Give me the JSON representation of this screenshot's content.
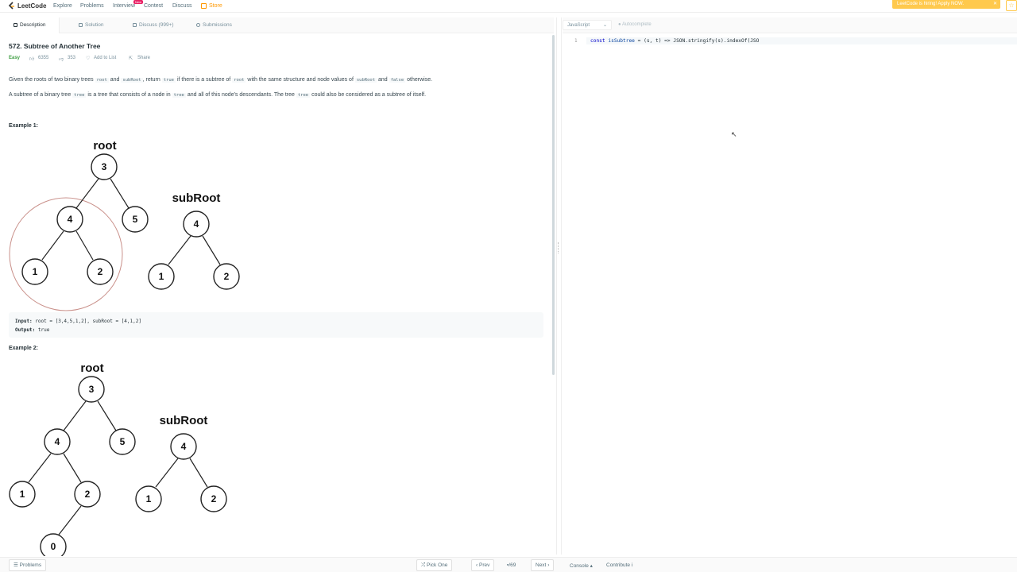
{
  "nav": {
    "logo": "LeetCode",
    "items": [
      "Explore",
      "Problems",
      "Interview",
      "Contest",
      "Discuss",
      "Store"
    ],
    "new_badge": "New",
    "hiring": "LeetCode is hiring! Apply NOW."
  },
  "tabs": [
    "Description",
    "Solution",
    "Discuss (999+)",
    "Submissions"
  ],
  "problem": {
    "title": "572. Subtree of Another Tree",
    "difficulty": "Easy",
    "likes": "6355",
    "dislikes": "353",
    "add_to_list": "Add to List",
    "share": "Share",
    "p1": {
      "a": "Given the roots of two binary trees",
      "c1": "root",
      "b": "and",
      "c2": "subRoot",
      "c": ", return",
      "c3": "true",
      "d": "if there is a subtree of",
      "c4": "root",
      "e": "with the same structure and node values of",
      "c5": "subRoot",
      "f": "and",
      "c6": "false",
      "g": "otherwise."
    },
    "p2": {
      "a": "A subtree of a binary tree",
      "c1": "tree",
      "b": "is a tree that consists of a node in",
      "c2": "tree",
      "c": "and all of this node's descendants. The tree",
      "c3": "tree",
      "d": "could also be considered as a subtree of itself."
    },
    "example1": {
      "heading": "Example 1:",
      "root_label": "root",
      "sub_label": "subRoot",
      "root_nodes": [
        "3",
        "4",
        "5",
        "1",
        "2"
      ],
      "sub_nodes": [
        "4",
        "1",
        "2"
      ],
      "input_label": "Input:",
      "input": "root = [3,4,5,1,2], subRoot = [4,1,2]",
      "output_label": "Output:",
      "output": "true"
    },
    "example2": {
      "heading": "Example 2:",
      "root_label": "root",
      "sub_label": "subRoot",
      "root_nodes": [
        "3",
        "4",
        "5",
        "1",
        "2",
        "0"
      ],
      "sub_nodes": [
        "4",
        "1",
        "2"
      ]
    }
  },
  "editor": {
    "language": "JavaScript",
    "autocomplete": "Autocomplete",
    "line_number": "1",
    "code": {
      "k1": "const",
      "name": "isSubtree",
      "rest": "= (s, t) => JSON.stringify(s).indexOf(JSO"
    }
  },
  "bottom": {
    "problems": "Problems",
    "pick_one": "Pick One",
    "prev": "Prev",
    "page": "/69",
    "next": "Next",
    "console": "Console",
    "contribute": "Contribute"
  },
  "colors": {
    "easy": "#43a047",
    "highlight_circle": "#c9908a",
    "store": "#ff9800",
    "hiring_bg": "#ffc94d"
  }
}
